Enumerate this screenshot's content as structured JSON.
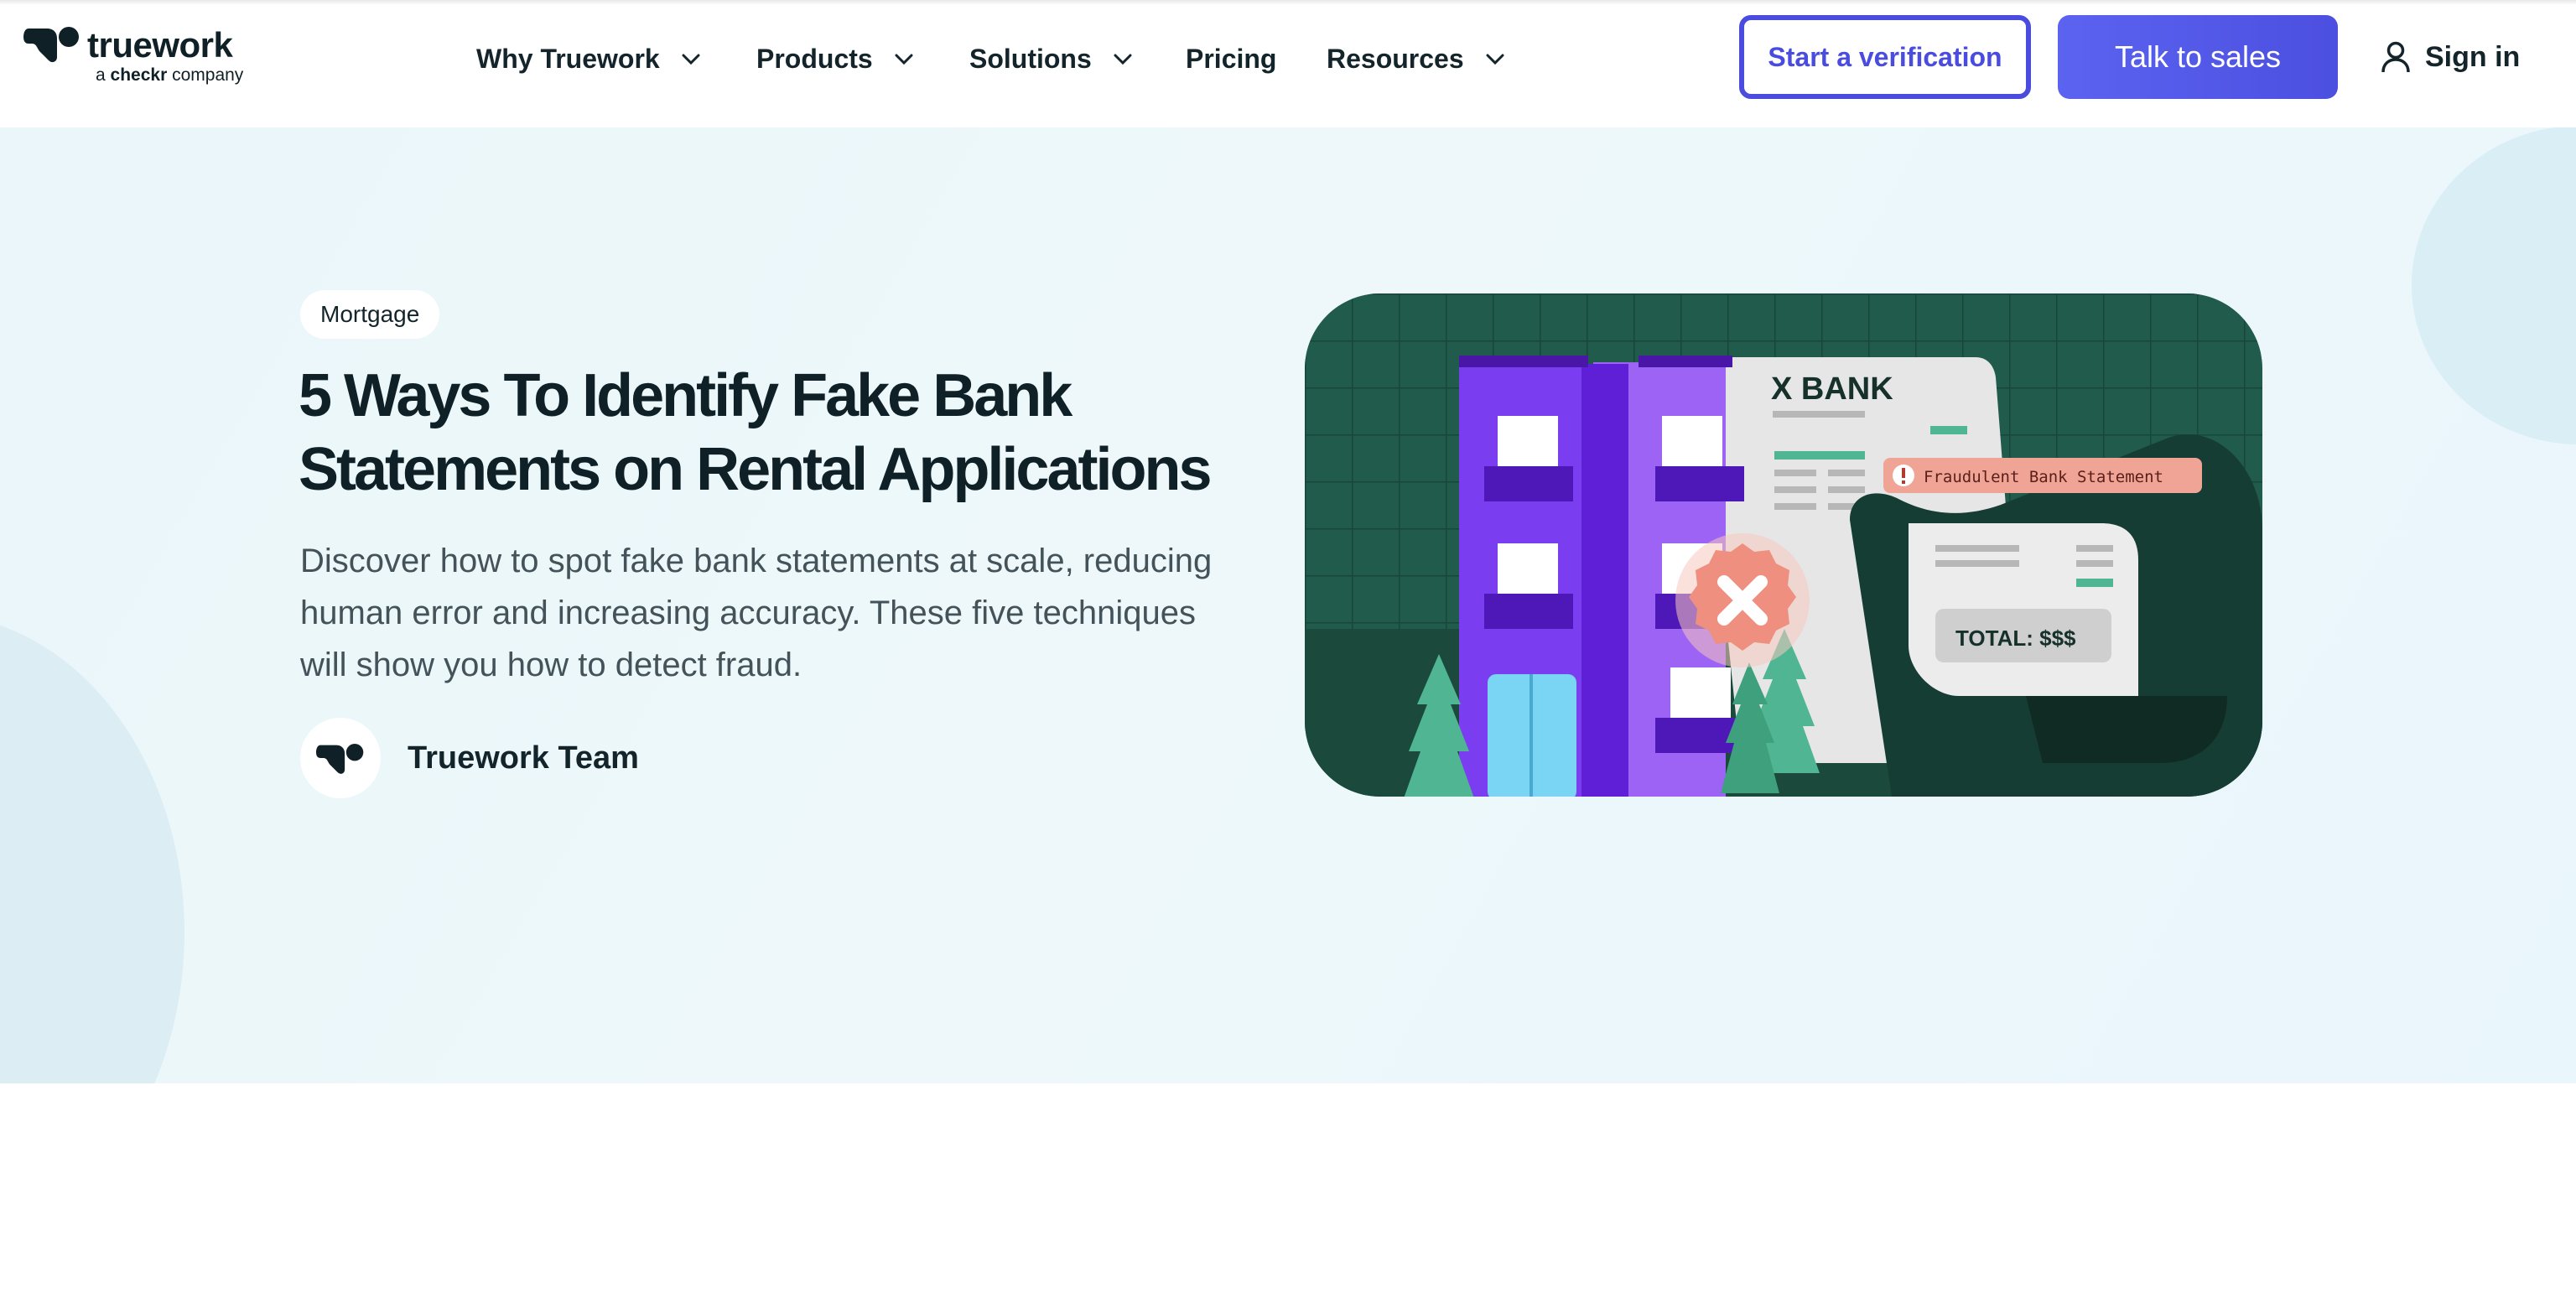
{
  "header": {
    "logo": {
      "wordmark": "truework",
      "sub_prefix": "a",
      "sub_brand": "checkr",
      "sub_suffix": "company"
    },
    "nav": [
      {
        "label": "Why Truework",
        "has_dropdown": true
      },
      {
        "label": "Products",
        "has_dropdown": true
      },
      {
        "label": "Solutions",
        "has_dropdown": true
      },
      {
        "label": "Pricing",
        "has_dropdown": false
      },
      {
        "label": "Resources",
        "has_dropdown": true
      }
    ],
    "start_verification_label": "Start a verification",
    "talk_to_sales_label": "Talk to sales",
    "sign_in_label": "Sign in"
  },
  "hero": {
    "tag": "Mortgage",
    "title": "5 Ways To Identify Fake Bank Statements on Rental Applications",
    "description": "Discover how to spot fake bank statements at scale, reducing human error and increasing accuracy. These five techniques will show you how to detect fraud.",
    "author": "Truework Team",
    "illustration": {
      "bank_name": "X BANK",
      "alert_text": "Fraudulent Bank Statement",
      "total_text": "TOTAL: $$$"
    }
  },
  "colors": {
    "brand_blue": "#4a4ce0",
    "text_dark": "#0f2027",
    "hero_bg": "#eaf6fa",
    "illus_green": "#1f5a4a",
    "building_purple": "#6b2be0"
  },
  "icons": [
    "truework-logo-icon",
    "chevron-down-icon",
    "user-icon",
    "x-badge-icon",
    "alert-icon"
  ]
}
